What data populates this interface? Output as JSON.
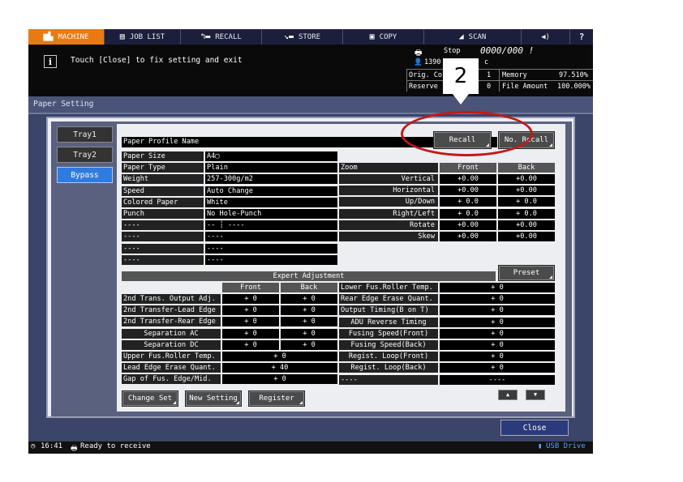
{
  "nav": {
    "machine": "MACHINE",
    "job_list": "JOB LIST",
    "recall": "RECALL",
    "store": "STORE",
    "copy": "COPY",
    "scan": "SCAN",
    "sound": "◀)",
    "help": "?"
  },
  "message": "Touch [Close] to fix setting and exit",
  "status": {
    "stop": "Stop",
    "counter": "0000/000 !",
    "user_count": "1390",
    "c": "c",
    "orig_label": "Orig. Co",
    "orig_val": "1",
    "reserve_label": "Reserve",
    "reserve_val": "0",
    "memory_label": "Memory",
    "memory_val": "97.510%",
    "file_label": "File Amount",
    "file_val": "100.000%"
  },
  "panel_title": "Paper Setting",
  "trays": [
    "Tray1",
    "Tray2",
    "Bypass"
  ],
  "profile": {
    "label": "Paper Profile Name",
    "recall_btn": "Recall",
    "no_recall_btn": "No. Recall"
  },
  "paper": {
    "rows": [
      [
        "Paper Size",
        "A4▢"
      ],
      [
        "Paper Type",
        "Plain"
      ],
      [
        "Weight",
        "257-300g/m2"
      ],
      [
        "Speed",
        "Auto Change"
      ],
      [
        "Colored Paper",
        "White"
      ],
      [
        "Punch",
        "No Hole-Punch"
      ],
      [
        "----",
        "-- ┆ ----"
      ],
      [
        "----",
        "----"
      ],
      [
        "----",
        "----"
      ],
      [
        "----",
        "----"
      ]
    ]
  },
  "zoom": {
    "label": "Zoom",
    "front": "Front",
    "back": "Back",
    "rows": [
      [
        "Vertical",
        "+0.00",
        "+0.00"
      ],
      [
        "Horizontal",
        "+0.00",
        "+0.00"
      ],
      [
        "Up/Down",
        "+ 0.0",
        "+ 0.0"
      ],
      [
        "Right/Left",
        "+ 0.0",
        "+ 0.0"
      ],
      [
        "Rotate",
        "+0.00",
        "+0.00"
      ],
      [
        "Skew",
        "+0.00",
        "+0.00"
      ]
    ]
  },
  "expert": {
    "title": "Expert Adjustment",
    "preset_btn": "Preset",
    "front": "Front",
    "back": "Back",
    "left_rows": [
      [
        "2nd Trans. Output Adj.",
        "+ 0",
        "+ 0"
      ],
      [
        "2nd Transfer-Lead Edge",
        "+ 0",
        "+ 0"
      ],
      [
        "2nd Transfer-Rear Edge",
        "+ 0",
        "+ 0"
      ],
      [
        "Separation AC",
        "+ 0",
        "+ 0"
      ],
      [
        "Separation DC",
        "+ 0",
        "+ 0"
      ]
    ],
    "wide_rows": [
      [
        "Upper Fus.Roller Temp.",
        "+ 0"
      ],
      [
        "Lead Edge Erase Quant.",
        "+ 40"
      ],
      [
        "Gap of Fus. Edge/Mid.",
        "+ 0"
      ]
    ],
    "right_rows": [
      [
        "Lower Fus.Roller Temp.",
        "+ 0"
      ],
      [
        "Rear Edge Erase Quant.",
        "+ 0"
      ],
      [
        "Output Timing(B on T)",
        "+ 0"
      ],
      [
        "ADU Reverse Timing",
        "+ 0"
      ],
      [
        "Fusing Speed(Front)",
        "+ 0"
      ],
      [
        "Fusing Speed(Back)",
        "+ 0"
      ],
      [
        "Regist. Loop(Front)",
        "+ 0"
      ],
      [
        "Regist. Loop(Back)",
        "+ 0"
      ],
      [
        "----",
        "----"
      ]
    ]
  },
  "buttons": {
    "change_set": "Change Set",
    "new_setting": "New Setting",
    "register": "Register",
    "up": "▲",
    "down": "▼",
    "close": "Close"
  },
  "statusbar": {
    "time": "16:41",
    "ready": "Ready to receive",
    "usb": "USB Drive"
  },
  "callout": "2",
  "colors": {
    "accent": "#e87a12",
    "selected": "#2f7be0",
    "callout_ring": "#c01a1a"
  }
}
